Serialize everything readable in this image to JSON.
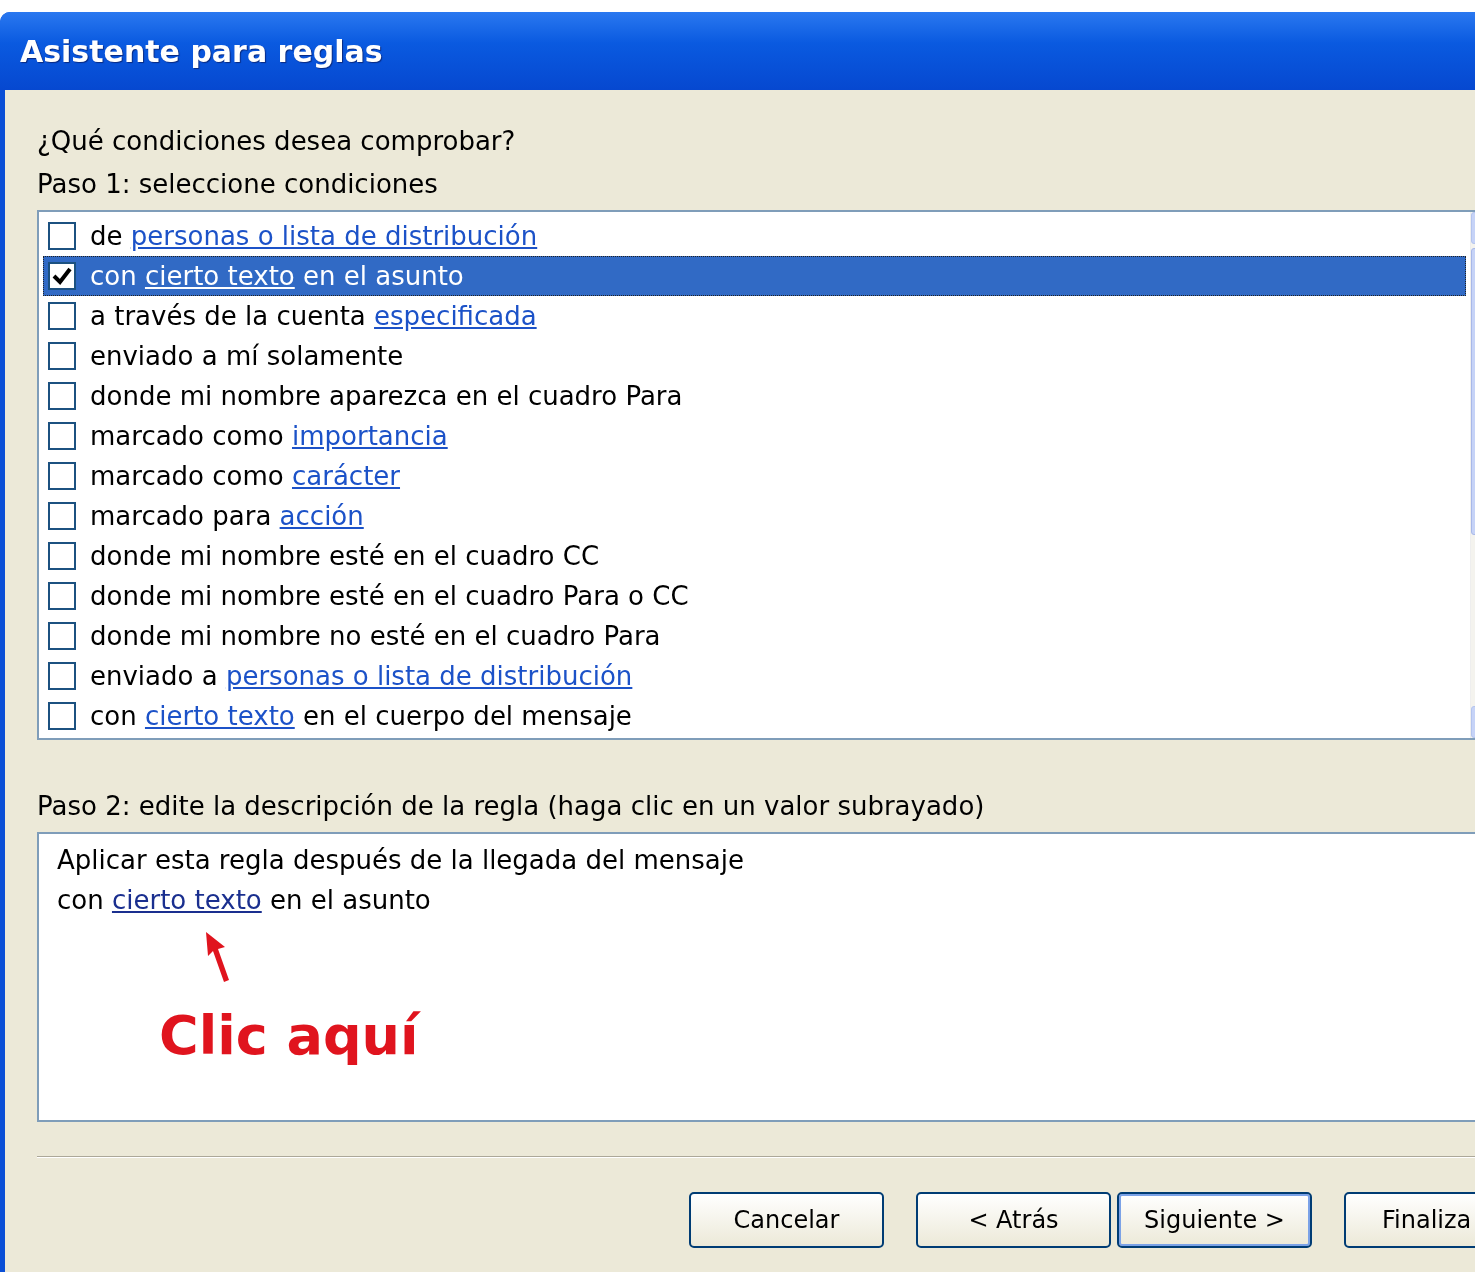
{
  "window": {
    "title": "Asistente para reglas"
  },
  "question": "¿Qué condiciones desea comprobar?",
  "step1": {
    "label": "Paso 1: seleccione condiciones",
    "conditions": [
      {
        "checked": false,
        "selected": false,
        "parts": [
          {
            "kind": "text",
            "text": "de "
          },
          {
            "kind": "link",
            "text": "personas o lista de distribución"
          }
        ]
      },
      {
        "checked": true,
        "selected": true,
        "parts": [
          {
            "kind": "text",
            "text": "con "
          },
          {
            "kind": "link",
            "text": "cierto texto"
          },
          {
            "kind": "text",
            "text": " en el asunto"
          }
        ]
      },
      {
        "checked": false,
        "selected": false,
        "parts": [
          {
            "kind": "text",
            "text": "a través de la cuenta "
          },
          {
            "kind": "link",
            "text": "especificada"
          }
        ]
      },
      {
        "checked": false,
        "selected": false,
        "parts": [
          {
            "kind": "text",
            "text": "enviado a mí solamente"
          }
        ]
      },
      {
        "checked": false,
        "selected": false,
        "parts": [
          {
            "kind": "text",
            "text": "donde mi nombre aparezca en el cuadro Para"
          }
        ]
      },
      {
        "checked": false,
        "selected": false,
        "parts": [
          {
            "kind": "text",
            "text": "marcado como "
          },
          {
            "kind": "link",
            "text": "importancia"
          }
        ]
      },
      {
        "checked": false,
        "selected": false,
        "parts": [
          {
            "kind": "text",
            "text": "marcado como "
          },
          {
            "kind": "link",
            "text": "carácter"
          }
        ]
      },
      {
        "checked": false,
        "selected": false,
        "parts": [
          {
            "kind": "text",
            "text": "marcado para "
          },
          {
            "kind": "link",
            "text": "acción"
          }
        ]
      },
      {
        "checked": false,
        "selected": false,
        "parts": [
          {
            "kind": "text",
            "text": "donde mi nombre esté en el cuadro CC"
          }
        ]
      },
      {
        "checked": false,
        "selected": false,
        "parts": [
          {
            "kind": "text",
            "text": "donde mi nombre esté en el cuadro Para o CC"
          }
        ]
      },
      {
        "checked": false,
        "selected": false,
        "parts": [
          {
            "kind": "text",
            "text": "donde mi nombre no esté en el cuadro Para"
          }
        ]
      },
      {
        "checked": false,
        "selected": false,
        "parts": [
          {
            "kind": "text",
            "text": "enviado a "
          },
          {
            "kind": "link",
            "text": "personas o lista de distribución"
          }
        ]
      },
      {
        "checked": false,
        "selected": false,
        "parts": [
          {
            "kind": "text",
            "text": "con "
          },
          {
            "kind": "link",
            "text": "cierto texto"
          },
          {
            "kind": "text",
            "text": " en el cuerpo del mensaje"
          }
        ]
      }
    ]
  },
  "step2": {
    "label": "Paso 2: edite la descripción de la regla (haga clic en un valor subrayado)",
    "lines": [
      [
        {
          "kind": "text",
          "text": "Aplicar esta regla después de la llegada del mensaje"
        }
      ],
      [
        {
          "kind": "text",
          "text": "con "
        },
        {
          "kind": "link",
          "text": "cierto texto"
        },
        {
          "kind": "text",
          "text": " en el asunto"
        }
      ]
    ],
    "annotation": "Clic aquí"
  },
  "buttons": [
    {
      "label": "Cancelar",
      "default": false
    },
    {
      "label": "< Atrás",
      "default": false
    },
    {
      "label": "Siguiente >",
      "default": true
    },
    {
      "label": "Finaliza",
      "default": false
    }
  ]
}
